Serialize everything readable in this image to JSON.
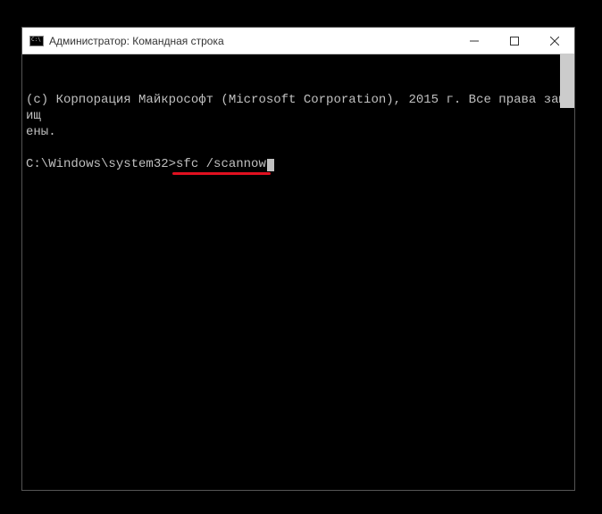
{
  "window": {
    "title": "Администратор: Командная строка"
  },
  "console": {
    "copyright_line1": "(с) Корпорация Майкрософт (Microsoft Corporation), 2015 г. Все права защищ",
    "copyright_line2": "ены.",
    "prompt": "C:\\Windows\\system32>",
    "command": "sfc /scannow"
  },
  "controls": {
    "minimize": "—",
    "maximize": "☐",
    "close": "✕"
  }
}
